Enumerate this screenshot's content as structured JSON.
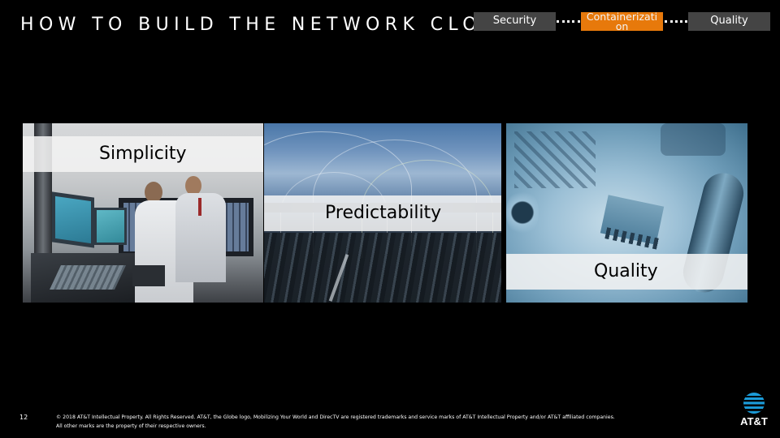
{
  "slide": {
    "title": "HOW TO BUILD THE NETWORK CLOUD",
    "page_number": "12"
  },
  "process": {
    "steps": [
      {
        "label": "Security",
        "state": "inactive",
        "color": "#444444"
      },
      {
        "label": "Containerizati on",
        "state": "active",
        "color": "#e7790b"
      },
      {
        "label": "Quality",
        "state": "inactive",
        "color": "#444444"
      }
    ]
  },
  "panels": [
    {
      "caption": "Simplicity",
      "image": "control-room-engineers-photo"
    },
    {
      "caption": "Predictability",
      "image": "city-network-connections-photo"
    },
    {
      "caption": "Quality",
      "image": "circuit-board-photo"
    }
  ],
  "footer": {
    "legal_line1": "© 2018 AT&T Intellectual Property.  All Rights Reserved.  AT&T, the Globe logo, Mobilizing Your World and DirecTV are registered trademarks and service marks of AT&T Intellectual Property and/or AT&T affiliated companies.",
    "legal_line2": "All other marks are the property of their respective owners.",
    "logo_text": "AT&T",
    "logo_icon": "att-globe-icon"
  }
}
